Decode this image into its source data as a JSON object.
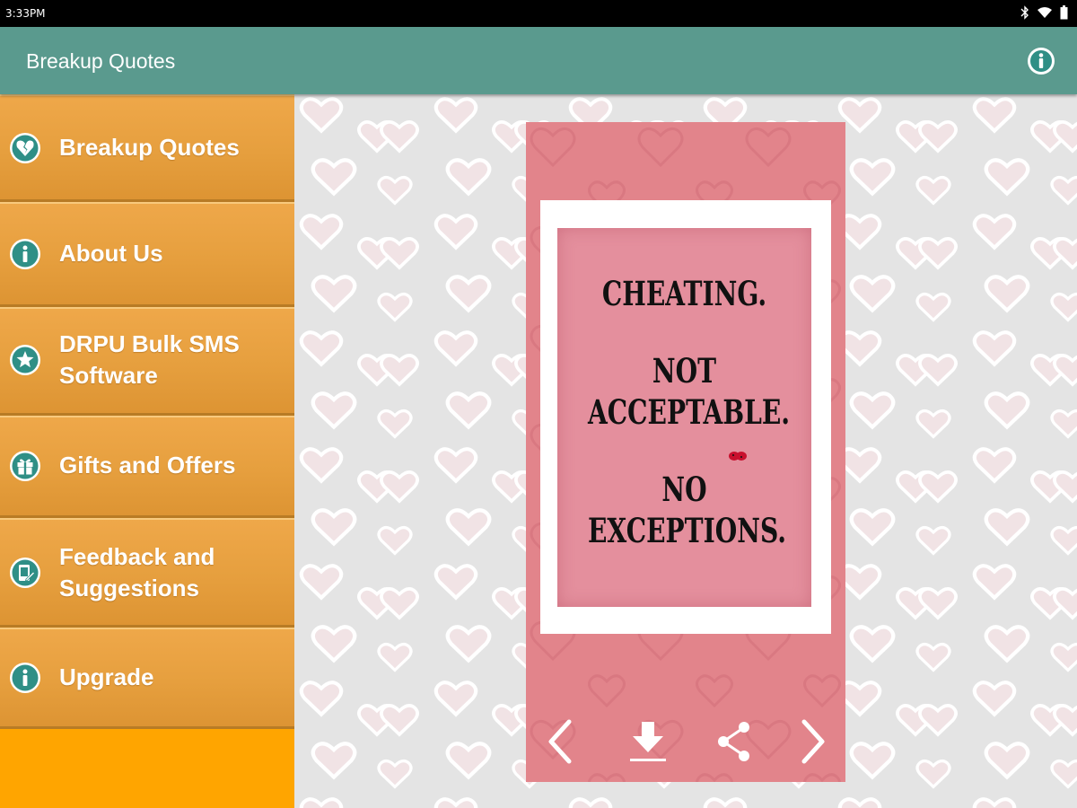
{
  "status_bar": {
    "time": "3:33PM",
    "icons": [
      "bluetooth-icon",
      "wifi-icon",
      "battery-icon"
    ]
  },
  "app_bar": {
    "title": "Breakup Quotes",
    "action_icon": "info-icon"
  },
  "drawer": {
    "items": [
      {
        "label": "Breakup Quotes",
        "icon": "broken-heart-icon"
      },
      {
        "label": "About Us",
        "icon": "info-icon"
      },
      {
        "label": "DRPU Bulk SMS Software",
        "icon": "star-icon"
      },
      {
        "label": "Gifts and Offers",
        "icon": "gift-icon"
      },
      {
        "label": "Feedback and Suggestions",
        "icon": "feedback-icon"
      },
      {
        "label": "Upgrade",
        "icon": "info-icon"
      }
    ]
  },
  "quote": {
    "lines": [
      "CHEATING.",
      "NOT",
      "ACCEPTABLE.",
      "NO",
      "EXCEPTIONS."
    ]
  },
  "controls": [
    "previous-icon",
    "download-icon",
    "share-icon",
    "next-icon"
  ],
  "colors": {
    "app_bar": "#5a9a8e",
    "drawer": "#e69f3e",
    "drawer_footer": "#ffa500",
    "card": "#e2848b",
    "paper": "#e48f9d",
    "background": "#e4e4e4"
  }
}
